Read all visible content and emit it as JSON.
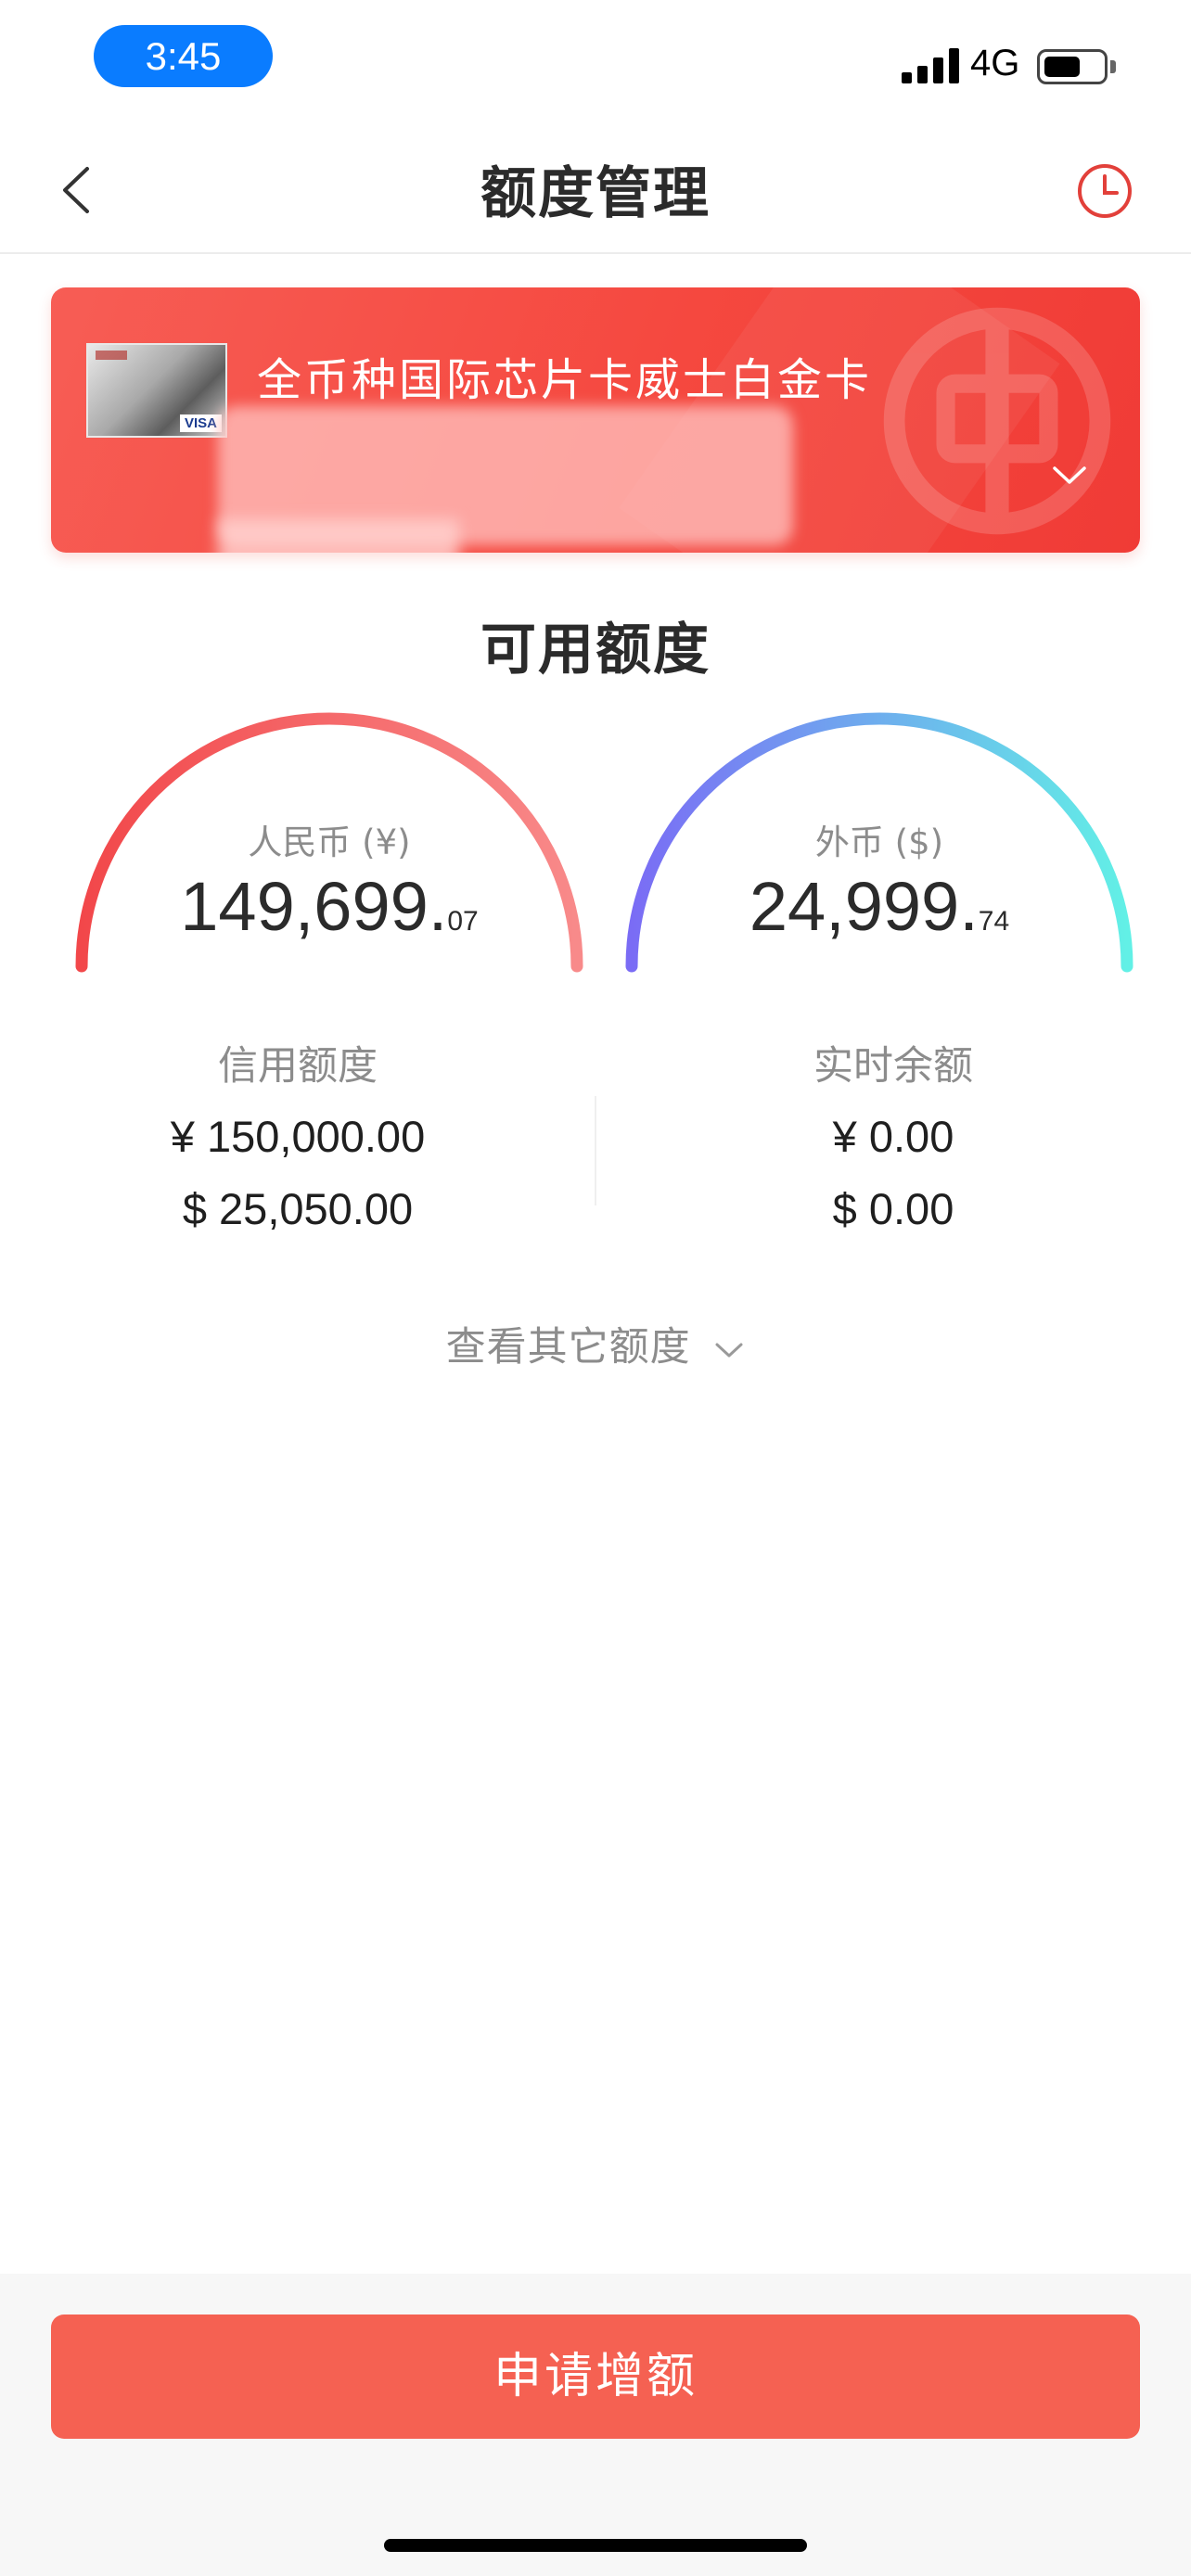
{
  "status_bar": {
    "time": "3:45",
    "network": "4G"
  },
  "nav": {
    "title": "额度管理",
    "back_icon": "chevron-left-icon",
    "history_icon": "clock-icon"
  },
  "card": {
    "name": "全币种国际芯片卡威士白金卡",
    "brand": "VISA"
  },
  "section_title": "可用额度",
  "gauges": [
    {
      "label": "人民币 (¥)",
      "amount": "149,699.",
      "cents": "07",
      "colors": [
        "#f2474a",
        "#f88a8a"
      ]
    },
    {
      "label": "外币 ($)",
      "amount": "24,999.",
      "cents": "74",
      "colors": [
        "#7a6cf5",
        "#62f0e6"
      ]
    }
  ],
  "credit": {
    "heading": "信用额度",
    "cny": "¥ 150,000.00",
    "usd": "$ 25,050.00"
  },
  "balance": {
    "heading": "实时余额",
    "cny": "¥ 0.00",
    "usd": "$ 0.00"
  },
  "more_link": "查看其它额度",
  "apply_button": "申请增额",
  "colors": {
    "accent": "#f56152",
    "card": "#f5483f",
    "text_secondary": "#8c8c8c"
  }
}
